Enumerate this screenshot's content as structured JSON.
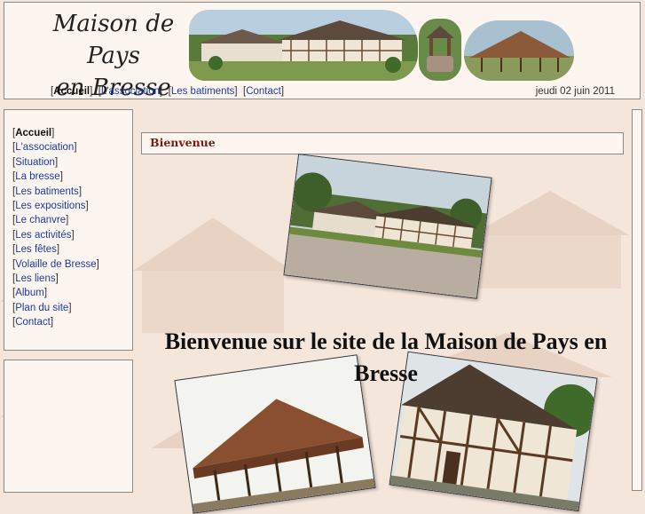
{
  "header": {
    "title_line1": "Maison de Pays",
    "title_line2": "en Bresse",
    "date": "jeudi 02 juin 2011"
  },
  "topnav": {
    "items": [
      {
        "label": "Accueil",
        "current": true
      },
      {
        "label": "L'association"
      },
      {
        "label": "Les batiments"
      },
      {
        "label": "Contact"
      }
    ]
  },
  "sidebar": {
    "items": [
      {
        "label": "Accueil",
        "current": true
      },
      {
        "label": "L'association"
      },
      {
        "label": "Situation"
      },
      {
        "label": "La bresse"
      },
      {
        "label": "Les batiments"
      },
      {
        "label": "Les expositions"
      },
      {
        "label": "Le chanvre"
      },
      {
        "label": "Les activités"
      },
      {
        "label": "Les fêtes"
      },
      {
        "label": "Volaille de Bresse"
      },
      {
        "label": "Les liens"
      },
      {
        "label": "Album"
      },
      {
        "label": "Plan du site"
      },
      {
        "label": "Contact"
      }
    ]
  },
  "content": {
    "heading": "Bienvenue",
    "welcome": "Bienvenue sur le site de la Maison de Pays en Bresse"
  },
  "colors": {
    "page_bg": "#f5e6dc",
    "panel_bg": "#fdf6f0",
    "link": "#1a3aa0",
    "heading": "#7a1a10"
  }
}
